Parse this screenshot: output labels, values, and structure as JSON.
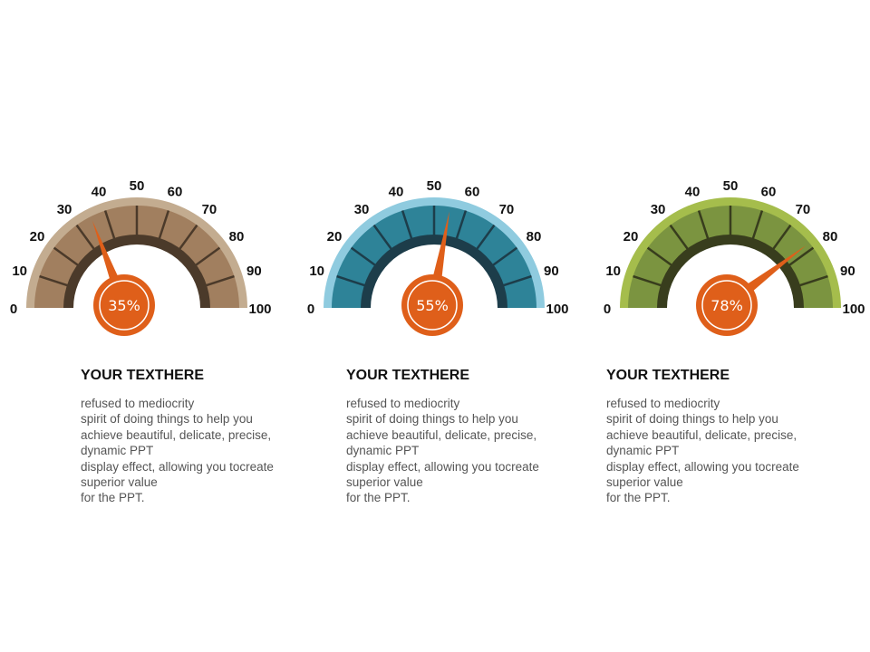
{
  "gauges": [
    {
      "value": 35,
      "label": "35%",
      "scale": [
        "0",
        "10",
        "20",
        "30",
        "40",
        "50",
        "60",
        "70",
        "80",
        "90",
        "100"
      ],
      "colors": {
        "band": "#a17f5f",
        "rim": "#c3ac90",
        "inner": "#4b3a2a",
        "divider": "#4b3a2a"
      }
    },
    {
      "value": 55,
      "label": "55%",
      "scale": [
        "0",
        "10",
        "20",
        "30",
        "40",
        "50",
        "60",
        "70",
        "80",
        "90",
        "100"
      ],
      "colors": {
        "band": "#2e8398",
        "rim": "#8fcbdf",
        "inner": "#1d3d4a",
        "divider": "#1d3d4a"
      }
    },
    {
      "value": 78,
      "label": "78%",
      "scale": [
        "0",
        "10",
        "20",
        "30",
        "40",
        "50",
        "60",
        "70",
        "80",
        "90",
        "100"
      ],
      "colors": {
        "band": "#7b9440",
        "rim": "#a5bd4c",
        "inner": "#383d1d",
        "divider": "#383d1d"
      }
    }
  ],
  "accent": "#df5f1a",
  "blocks": [
    {
      "title": "YOUR TEXTHERE",
      "lines": [
        "refused to mediocrity",
        "spirit of doing things to help you",
        "achieve beautiful, delicate, precise,",
        "dynamic PPT",
        "display effect, allowing you tocreate",
        "superior value",
        "for the PPT."
      ]
    },
    {
      "title": "YOUR TEXTHERE",
      "lines": [
        "refused to mediocrity",
        "spirit of doing things to help you",
        "achieve beautiful, delicate, precise,",
        "dynamic PPT",
        "display effect, allowing you tocreate",
        "superior value",
        "for the PPT."
      ]
    },
    {
      "title": "YOUR TEXTHERE",
      "lines": [
        "refused to mediocrity",
        "spirit of doing things to help you",
        "achieve beautiful, delicate, precise,",
        "dynamic PPT",
        "display effect, allowing you tocreate",
        "superior value",
        "for the PPT."
      ]
    }
  ]
}
